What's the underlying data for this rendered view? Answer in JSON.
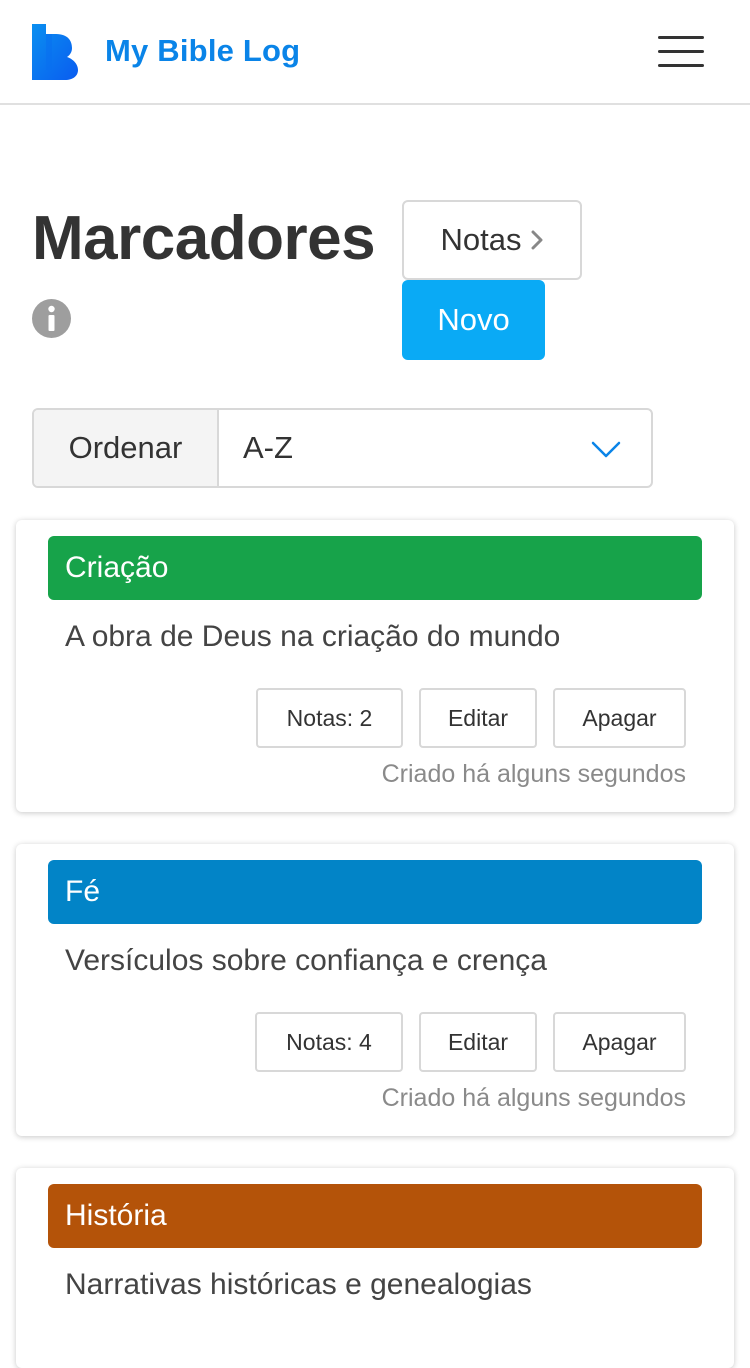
{
  "header": {
    "app_title": "My Bible Log",
    "logo_color": "#0a84e8",
    "icons": {
      "menu": "hamburger-menu-icon",
      "logo": "bible-log-logo-icon"
    }
  },
  "page": {
    "title": "Marcadores",
    "info_icon": "info-icon",
    "notes_button_label": "Notas",
    "new_button_label": "Novo",
    "new_button_color": "#0aaaf5"
  },
  "sort": {
    "label": "Ordenar",
    "selected": "A-Z",
    "icon": "chevron-down-icon"
  },
  "bookmarks": [
    {
      "title": "Criação",
      "color": "#17a34a",
      "description": "A obra de Deus na criação do mundo",
      "notes_label": "Notas: 2",
      "edit_label": "Editar",
      "delete_label": "Apagar",
      "created": "Criado há alguns segundos"
    },
    {
      "title": "Fé",
      "color": "#0284c7",
      "description": "Versículos sobre confiança e crença",
      "notes_label": "Notas: 4",
      "edit_label": "Editar",
      "delete_label": "Apagar",
      "created": "Criado há alguns segundos"
    },
    {
      "title": "História",
      "color": "#b45309",
      "description": "Narrativas históricas e genealogias"
    }
  ]
}
